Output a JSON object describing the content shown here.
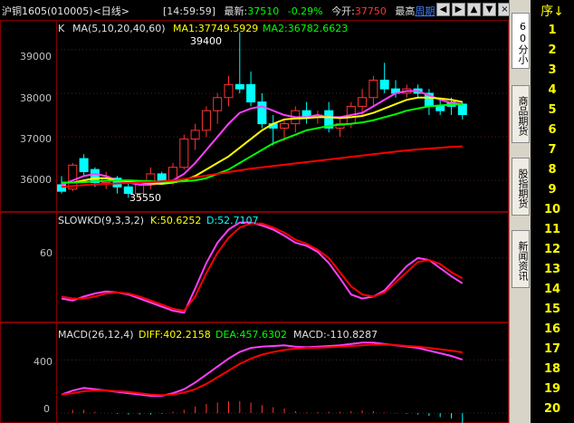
{
  "header": {
    "title": "沪铜1605(010005)<日线>",
    "time": "[14:59:59]",
    "latest_label": "最新:",
    "latest_value": "37510",
    "change": "-0.29%",
    "open_label": "今开:",
    "open_value": "37750",
    "highest_label": "最高",
    "period_link": "周期",
    "colors": {
      "up": "#ff3333",
      "down": "#00ffff",
      "text": "#c0c0c0"
    }
  },
  "window_buttons": [
    {
      "icon": "arrow-left-icon",
      "glyph": "◀"
    },
    {
      "icon": "arrow-right-icon",
      "glyph": "▶"
    },
    {
      "icon": "arrow-up-icon",
      "glyph": "▲"
    },
    {
      "icon": "arrow-down-icon",
      "glyph": "▼"
    },
    {
      "icon": "window-close-icon",
      "glyph": "×"
    }
  ],
  "kline_panel": {
    "legend_prefix": "K",
    "ma_label": "MA(5,10,20,40,60)",
    "ma1": "MA1:37749.5929",
    "ma2": "MA2:36782.6623",
    "y_ticks": [
      "39000",
      "38000",
      "37000",
      "36000"
    ],
    "high_marker": "39400",
    "low_marker": "35550"
  },
  "kd_panel": {
    "label": "SLOWKD(9,3,3,2)",
    "k": "K:50.6252",
    "d": "D:52.7107",
    "y_ticks": [
      "60"
    ]
  },
  "macd_panel": {
    "label": "MACD(26,12,4)",
    "diff": "DIFF:402.2158",
    "dea": "DEA:457.6302",
    "macd": "MACD:-110.8287",
    "y_ticks": [
      "400",
      "0"
    ]
  },
  "side_tabs": [
    {
      "label": "60分小",
      "active": true
    },
    {
      "label": "商品期货",
      "active": false
    },
    {
      "label": "股指期货",
      "active": false
    },
    {
      "label": "新闻资讯",
      "active": false
    }
  ],
  "sequence": {
    "header": "序↓",
    "items": [
      "1",
      "2",
      "3",
      "4",
      "5",
      "6",
      "7",
      "8",
      "9",
      "10",
      "11",
      "12",
      "13",
      "14",
      "15",
      "16",
      "17",
      "18",
      "19",
      "20"
    ]
  },
  "chart_data": [
    {
      "type": "candlestick",
      "title": "K",
      "ylim": [
        35400,
        39600
      ],
      "y_ticks": [
        36000,
        37000,
        38000,
        39000
      ],
      "candles": [
        {
          "o": 35900,
          "h": 36100,
          "l": 35700,
          "c": 35750
        },
        {
          "o": 35800,
          "h": 36400,
          "l": 35750,
          "c": 36350
        },
        {
          "o": 36500,
          "h": 36600,
          "l": 36100,
          "c": 36200
        },
        {
          "o": 36250,
          "h": 36300,
          "l": 35850,
          "c": 35950
        },
        {
          "o": 35950,
          "h": 36200,
          "l": 35800,
          "c": 36050
        },
        {
          "o": 36050,
          "h": 36100,
          "l": 35700,
          "c": 35850
        },
        {
          "o": 35850,
          "h": 36000,
          "l": 35600,
          "c": 35700
        },
        {
          "o": 35700,
          "h": 36000,
          "l": 35550,
          "c": 35900
        },
        {
          "o": 35900,
          "h": 36300,
          "l": 35800,
          "c": 36150
        },
        {
          "o": 36150,
          "h": 36200,
          "l": 35900,
          "c": 35950
        },
        {
          "o": 35950,
          "h": 36400,
          "l": 35900,
          "c": 36300
        },
        {
          "o": 36300,
          "h": 37050,
          "l": 36250,
          "c": 36950
        },
        {
          "o": 36950,
          "h": 37300,
          "l": 36700,
          "c": 37150
        },
        {
          "o": 37150,
          "h": 37700,
          "l": 37000,
          "c": 37600
        },
        {
          "o": 37600,
          "h": 38000,
          "l": 37300,
          "c": 37900
        },
        {
          "o": 37900,
          "h": 38400,
          "l": 37700,
          "c": 38200
        },
        {
          "o": 38200,
          "h": 39400,
          "l": 38000,
          "c": 38100
        },
        {
          "o": 38200,
          "h": 38500,
          "l": 37700,
          "c": 37800
        },
        {
          "o": 37800,
          "h": 38000,
          "l": 37200,
          "c": 37300
        },
        {
          "o": 37300,
          "h": 37500,
          "l": 36800,
          "c": 37200
        },
        {
          "o": 37200,
          "h": 37400,
          "l": 36900,
          "c": 37300
        },
        {
          "o": 37300,
          "h": 37700,
          "l": 37100,
          "c": 37600
        },
        {
          "o": 37600,
          "h": 37800,
          "l": 37300,
          "c": 37450
        },
        {
          "o": 37450,
          "h": 37600,
          "l": 37300,
          "c": 37500
        },
        {
          "o": 37600,
          "h": 37800,
          "l": 37100,
          "c": 37200
        },
        {
          "o": 37200,
          "h": 37400,
          "l": 37000,
          "c": 37300
        },
        {
          "o": 37300,
          "h": 37800,
          "l": 37200,
          "c": 37700
        },
        {
          "o": 37700,
          "h": 38100,
          "l": 37500,
          "c": 37900
        },
        {
          "o": 37900,
          "h": 38400,
          "l": 37700,
          "c": 38300
        },
        {
          "o": 38300,
          "h": 38700,
          "l": 38000,
          "c": 38100
        },
        {
          "o": 38100,
          "h": 38300,
          "l": 37900,
          "c": 38000
        },
        {
          "o": 38000,
          "h": 38200,
          "l": 37900,
          "c": 38100
        },
        {
          "o": 38100,
          "h": 38200,
          "l": 37900,
          "c": 38000
        },
        {
          "o": 38000,
          "h": 38100,
          "l": 37500,
          "c": 37700
        },
        {
          "o": 37700,
          "h": 37900,
          "l": 37500,
          "c": 37600
        },
        {
          "o": 37800,
          "h": 37900,
          "l": 37500,
          "c": 37700
        },
        {
          "o": 37750,
          "h": 37800,
          "l": 37400,
          "c": 37510
        }
      ],
      "series": [
        {
          "color": "#ff40ff",
          "values": [
            35900,
            36000,
            36100,
            36150,
            36100,
            36000,
            35950,
            35900,
            35900,
            35950,
            36000,
            36150,
            36400,
            36700,
            37000,
            37300,
            37550,
            37650,
            37700,
            37600,
            37500,
            37450,
            37450,
            37500,
            37450,
            37450,
            37500,
            37550,
            37700,
            37850,
            38000,
            38050,
            38050,
            37950,
            37850,
            37780,
            37750
          ]
        },
        {
          "color": "#ffff00",
          "values": [
            35950,
            35950,
            36000,
            36050,
            36050,
            36000,
            35980,
            35950,
            35930,
            35920,
            35950,
            36000,
            36100,
            36250,
            36400,
            36550,
            36750,
            36950,
            37150,
            37300,
            37400,
            37420,
            37430,
            37450,
            37450,
            37430,
            37450,
            37480,
            37550,
            37650,
            37750,
            37850,
            37900,
            37900,
            37880,
            37850,
            37800
          ]
        },
        {
          "color": "#00ff00",
          "values": [
            35950,
            35950,
            35960,
            35980,
            35990,
            36000,
            36000,
            35990,
            35980,
            35970,
            35970,
            35980,
            36000,
            36050,
            36150,
            36250,
            36400,
            36550,
            36700,
            36850,
            36950,
            37050,
            37150,
            37200,
            37250,
            37280,
            37300,
            37330,
            37380,
            37450,
            37520,
            37600,
            37650,
            37700,
            37720,
            37740,
            37750
          ]
        },
        {
          "color": "#ff0000",
          "values": [
            35850,
            35870,
            35890,
            35910,
            35920,
            35930,
            35940,
            35950,
            35960,
            35980,
            36000,
            36030,
            36070,
            36110,
            36150,
            36190,
            36230,
            36270,
            36300,
            36330,
            36360,
            36390,
            36420,
            36450,
            36480,
            36510,
            36540,
            36570,
            36600,
            36630,
            36660,
            36690,
            36710,
            36730,
            36750,
            36770,
            36780
          ]
        }
      ]
    },
    {
      "type": "line",
      "title": "SLOWKD(9,3,3,2)",
      "ylim": [
        0,
        100
      ],
      "y_ticks": [
        60
      ],
      "series": [
        {
          "name": "K",
          "color": "#ff40ff",
          "values": [
            20,
            18,
            22,
            25,
            27,
            26,
            24,
            20,
            16,
            12,
            8,
            6,
            30,
            55,
            75,
            88,
            95,
            95,
            92,
            88,
            82,
            75,
            72,
            66,
            55,
            40,
            24,
            20,
            22,
            28,
            40,
            52,
            60,
            58,
            50,
            42,
            35
          ]
        },
        {
          "name": "D",
          "color": "#ff0000",
          "values": [
            22,
            20,
            20,
            22,
            25,
            26,
            25,
            22,
            18,
            14,
            10,
            8,
            22,
            45,
            65,
            80,
            90,
            94,
            94,
            90,
            85,
            78,
            74,
            68,
            60,
            46,
            32,
            24,
            22,
            26,
            36,
            46,
            56,
            58,
            54,
            46,
            40
          ]
        }
      ]
    },
    {
      "type": "line",
      "title": "MACD(26,12,4)",
      "ylim": [
        -40,
        600
      ],
      "y_ticks": [
        0,
        400
      ],
      "series": [
        {
          "name": "DIFF",
          "color": "#ff40ff",
          "values": [
            140,
            170,
            190,
            180,
            170,
            160,
            150,
            140,
            130,
            130,
            150,
            180,
            230,
            290,
            350,
            410,
            460,
            490,
            500,
            505,
            510,
            500,
            495,
            500,
            505,
            510,
            520,
            530,
            530,
            520,
            510,
            500,
            490,
            470,
            450,
            430,
            402
          ]
        },
        {
          "name": "DEA",
          "color": "#ff0000",
          "values": [
            140,
            150,
            165,
            170,
            170,
            165,
            160,
            150,
            140,
            135,
            140,
            155,
            180,
            220,
            270,
            320,
            370,
            410,
            440,
            460,
            475,
            485,
            490,
            492,
            495,
            500,
            505,
            510,
            515,
            515,
            512,
            505,
            500,
            490,
            480,
            470,
            457
          ]
        }
      ],
      "bars": [
        0,
        25,
        25,
        10,
        0,
        -5,
        -10,
        -10,
        -10,
        -5,
        10,
        25,
        50,
        70,
        80,
        90,
        90,
        80,
        60,
        45,
        35,
        15,
        5,
        8,
        10,
        10,
        15,
        20,
        15,
        5,
        -2,
        -5,
        -10,
        -20,
        -30,
        -40,
        -110
      ]
    }
  ]
}
